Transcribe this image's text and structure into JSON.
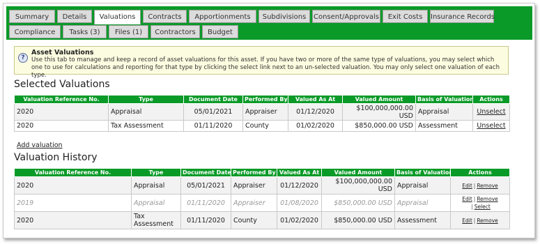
{
  "tabs": [
    {
      "label": "Summary",
      "active": false
    },
    {
      "label": "Details",
      "active": false
    },
    {
      "label": "Valuations",
      "active": true
    },
    {
      "label": "Contracts",
      "active": false
    },
    {
      "label": "Apportionments",
      "active": false
    },
    {
      "label": "Subdivisions",
      "active": false
    },
    {
      "label": "Consent/Approvals",
      "active": false
    },
    {
      "label": "Exit Costs",
      "active": false
    },
    {
      "label": "Insurance Records",
      "active": false
    },
    {
      "label": "Compliance",
      "active": false
    },
    {
      "label": "Tasks  (3)",
      "active": false
    },
    {
      "label": "Files  (1)",
      "active": false
    },
    {
      "label": "Contractors",
      "active": false
    },
    {
      "label": "Budget",
      "active": false
    }
  ],
  "info": {
    "icon": "question-icon",
    "title": "Asset Valuations",
    "text": "Use this tab to manage and keep a record of asset valuations for this asset. If you have two or more of the same type of valuations, you may select which one to use for calculations and reporting for that type by clicking the select link next to an un-selected valuation. You may only select one valuation of each type."
  },
  "selected": {
    "heading": "Selected Valuations",
    "columns": [
      "Valuation Reference No.",
      "Type",
      "Document Date",
      "Performed By",
      "Valued As At",
      "Valued Amount",
      "Basis of Valuation",
      "Actions"
    ],
    "rows": [
      {
        "ref": "2020",
        "type": "Appraisal",
        "doc_date": "05/01/2021",
        "by": "Appraiser",
        "as_at": "01/12/2020",
        "amount": "$100,000,000.00 USD",
        "basis": "Appraisal",
        "action": "Unselect"
      },
      {
        "ref": "2020",
        "type": "Tax Assessment",
        "doc_date": "01/11/2020",
        "by": "County",
        "as_at": "01/02/2020",
        "amount": "$850,000.00 USD",
        "basis": "Assessment",
        "action": "Unselect"
      }
    ]
  },
  "add_link": "Add valuation",
  "history": {
    "heading": "Valuation History",
    "columns": [
      "Valuation Reference No.",
      "Type",
      "Document Date",
      "Performed By",
      "Valued As At",
      "Valued Amount",
      "Basis of Valuation",
      "Actions"
    ],
    "rows": [
      {
        "ref": "2020",
        "type": "Appraisal",
        "doc_date": "05/01/2021",
        "by": "Appraiser",
        "as_at": "01/12/2020",
        "amount": "$100,000,000.00 USD",
        "basis": "Appraisal",
        "edit": "Edit",
        "remove": "Remove",
        "select": ""
      },
      {
        "ref": "2019",
        "type": "Appraisal",
        "doc_date": "01/11/2020",
        "by": "Appraiser",
        "as_at": "01/08/2020",
        "amount": "$850,000.00 USD",
        "basis": "Appraisal",
        "edit": "Edit",
        "remove": "Remove",
        "select": "Select"
      },
      {
        "ref": "2020",
        "type": "Tax Assessment",
        "doc_date": "01/11/2020",
        "by": "County",
        "as_at": "01/02/2020",
        "amount": "$850,000.00 USD",
        "basis": "Assessment",
        "edit": "Edit",
        "remove": "Remove",
        "select": ""
      }
    ]
  },
  "colors": {
    "accent": "#0a9a28",
    "info_bg": "#fcfce0",
    "row_shade": "#f2f2f2",
    "muted_text": "#999999"
  }
}
